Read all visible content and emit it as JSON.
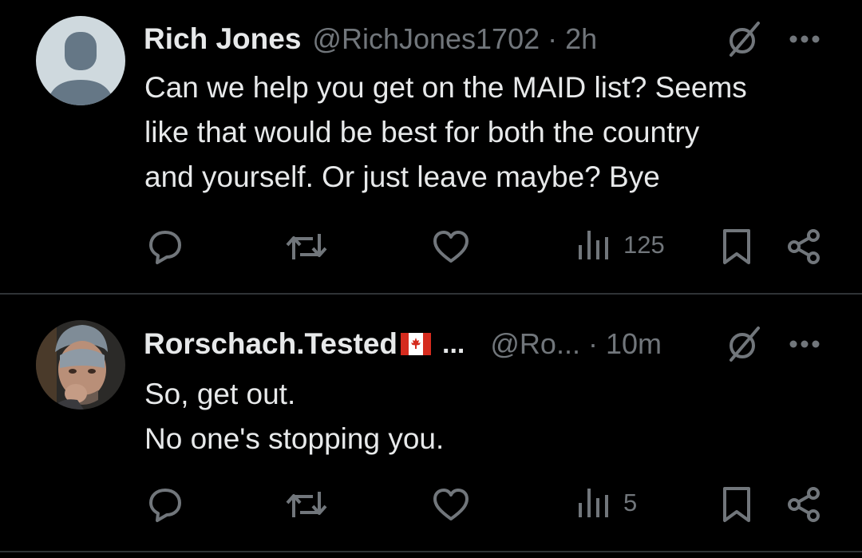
{
  "tweets": [
    {
      "name": "Rich Jones",
      "handle": "@RichJones1702",
      "separator": "·",
      "time": "2h",
      "lines": [
        "Can we help you get on the MAID list? Seems",
        "like that would be best for both the country",
        "and yourself. Or just leave maybe? Bye"
      ],
      "views": "125",
      "avatar": "default-avatar"
    },
    {
      "name": "Rorschach.Tested",
      "name_truncation": "...",
      "handle": "@Ro...",
      "separator": "·",
      "time": "10m",
      "lines": [
        "So, get out.",
        "No one's stopping you."
      ],
      "views": "5",
      "avatar": "photo-avatar"
    }
  ],
  "icons": {
    "grok": "slashed-circle-icon",
    "more": "more-icon",
    "reply": "reply-icon",
    "retweet": "retweet-icon",
    "like": "heart-icon",
    "views": "views-icon",
    "bookmark": "bookmark-icon",
    "share": "share-icon",
    "flag": "canada-flag-icon"
  },
  "colors": {
    "background": "#000000",
    "text": "#e7e9ea",
    "secondary": "#71767b",
    "divider": "#2f3336",
    "flag_red": "#d52b1e"
  }
}
